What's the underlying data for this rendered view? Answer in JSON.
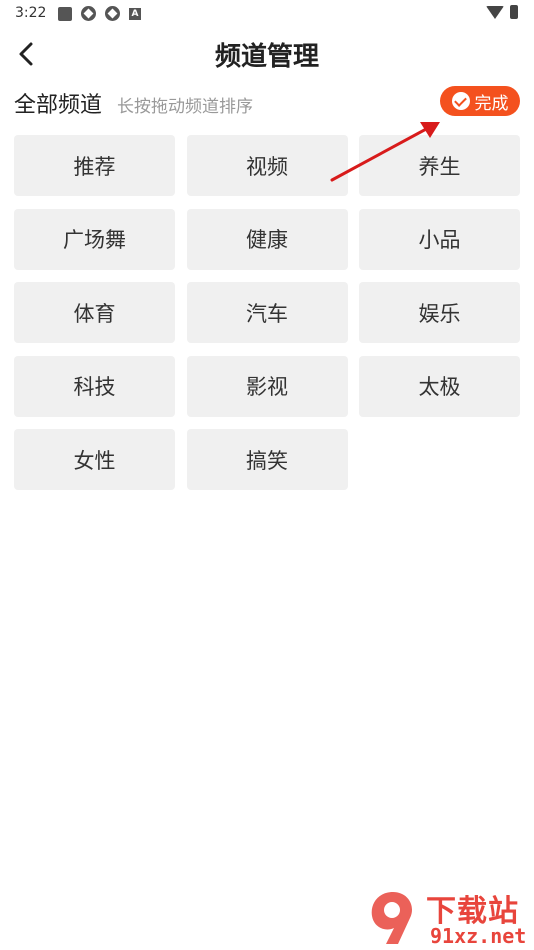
{
  "status_bar": {
    "time": "3:22"
  },
  "header": {
    "title": "频道管理"
  },
  "section": {
    "title": "全部频道",
    "hint": "长按拖动频道排序",
    "done_label": "完成"
  },
  "channels": [
    {
      "label": "推荐"
    },
    {
      "label": "视频"
    },
    {
      "label": "养生"
    },
    {
      "label": "广场舞"
    },
    {
      "label": "健康"
    },
    {
      "label": "小品"
    },
    {
      "label": "体育"
    },
    {
      "label": "汽车"
    },
    {
      "label": "娱乐"
    },
    {
      "label": "科技"
    },
    {
      "label": "影视"
    },
    {
      "label": "太极"
    },
    {
      "label": "女性"
    },
    {
      "label": "搞笑"
    }
  ],
  "watermark": {
    "brand": "下载站",
    "url": "91xz.net"
  },
  "colors": {
    "accent": "#f4511e",
    "chip_bg": "#f0f0f0",
    "annotation": "#d81b1b"
  }
}
